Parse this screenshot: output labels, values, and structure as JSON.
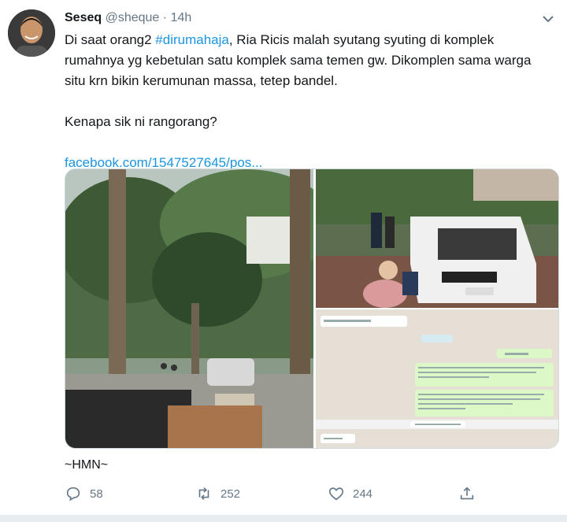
{
  "tweet": {
    "display_name": "Seseq",
    "handle": "@sheque",
    "separator": "·",
    "time": "14h",
    "text_line1_pre": "Di saat orang2 ",
    "hashtag": "#dirumahaja",
    "text_line1_post": ", Ria Ricis malah syutang syuting di komplek rumahnya yg kebetulan satu komplek sama temen gw. Dikomplen sama warga situ krn bikin kerumunan massa, tetep bandel.",
    "text_line2": "Kenapa sik ni rangorang?",
    "link": "facebook.com/1547527645/pos...",
    "signature": "~HMN~"
  },
  "actions": {
    "reply_count": "58",
    "retweet_count": "252",
    "like_count": "244"
  },
  "icons": [
    "chevron-down-icon",
    "reply-icon",
    "retweet-icon",
    "like-icon",
    "share-icon"
  ],
  "colors": {
    "link": "#1b95e0",
    "muted": "#657786",
    "text": "#14171a"
  }
}
